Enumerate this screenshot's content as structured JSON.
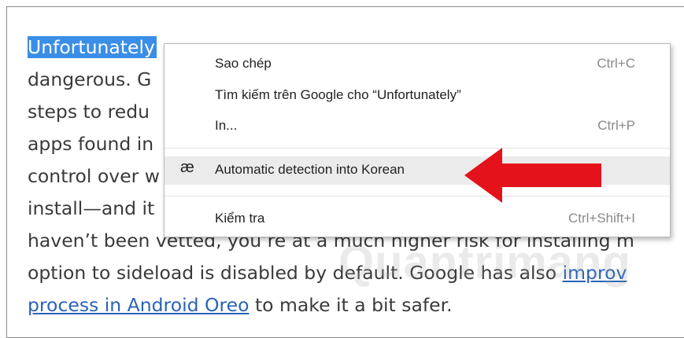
{
  "article": {
    "line1": "Unfortunately",
    "line2": "dangerous. G",
    "line3": "steps to redu",
    "line4": "apps found in",
    "line5": "control over w",
    "line6": "install—and it",
    "line7": "haven’t been vetted, you’re at a much higher risk for installing m",
    "line8_a": "option to sideload is disabled by default. Google has also ",
    "line8_link": "improv",
    "line9_link": "process in Android Oreo",
    "line9_b": " to make it a bit safer."
  },
  "context_menu": {
    "items": [
      {
        "label": "Sao chép",
        "shortcut": "Ctrl+C"
      },
      {
        "label": "Tìm kiếm trên Google cho “Unfortunately”",
        "shortcut": ""
      },
      {
        "label": "In...",
        "shortcut": "Ctrl+P"
      },
      {
        "label": "Automatic detection into Korean",
        "shortcut": "",
        "icon": "æ"
      },
      {
        "label": "Kiểm tra",
        "shortcut": "Ctrl+Shift+I"
      }
    ]
  },
  "annotation": {
    "arrow_color": "#e3121b"
  },
  "colors": {
    "selection": "#3a8ee6",
    "link": "#2a62b8"
  }
}
